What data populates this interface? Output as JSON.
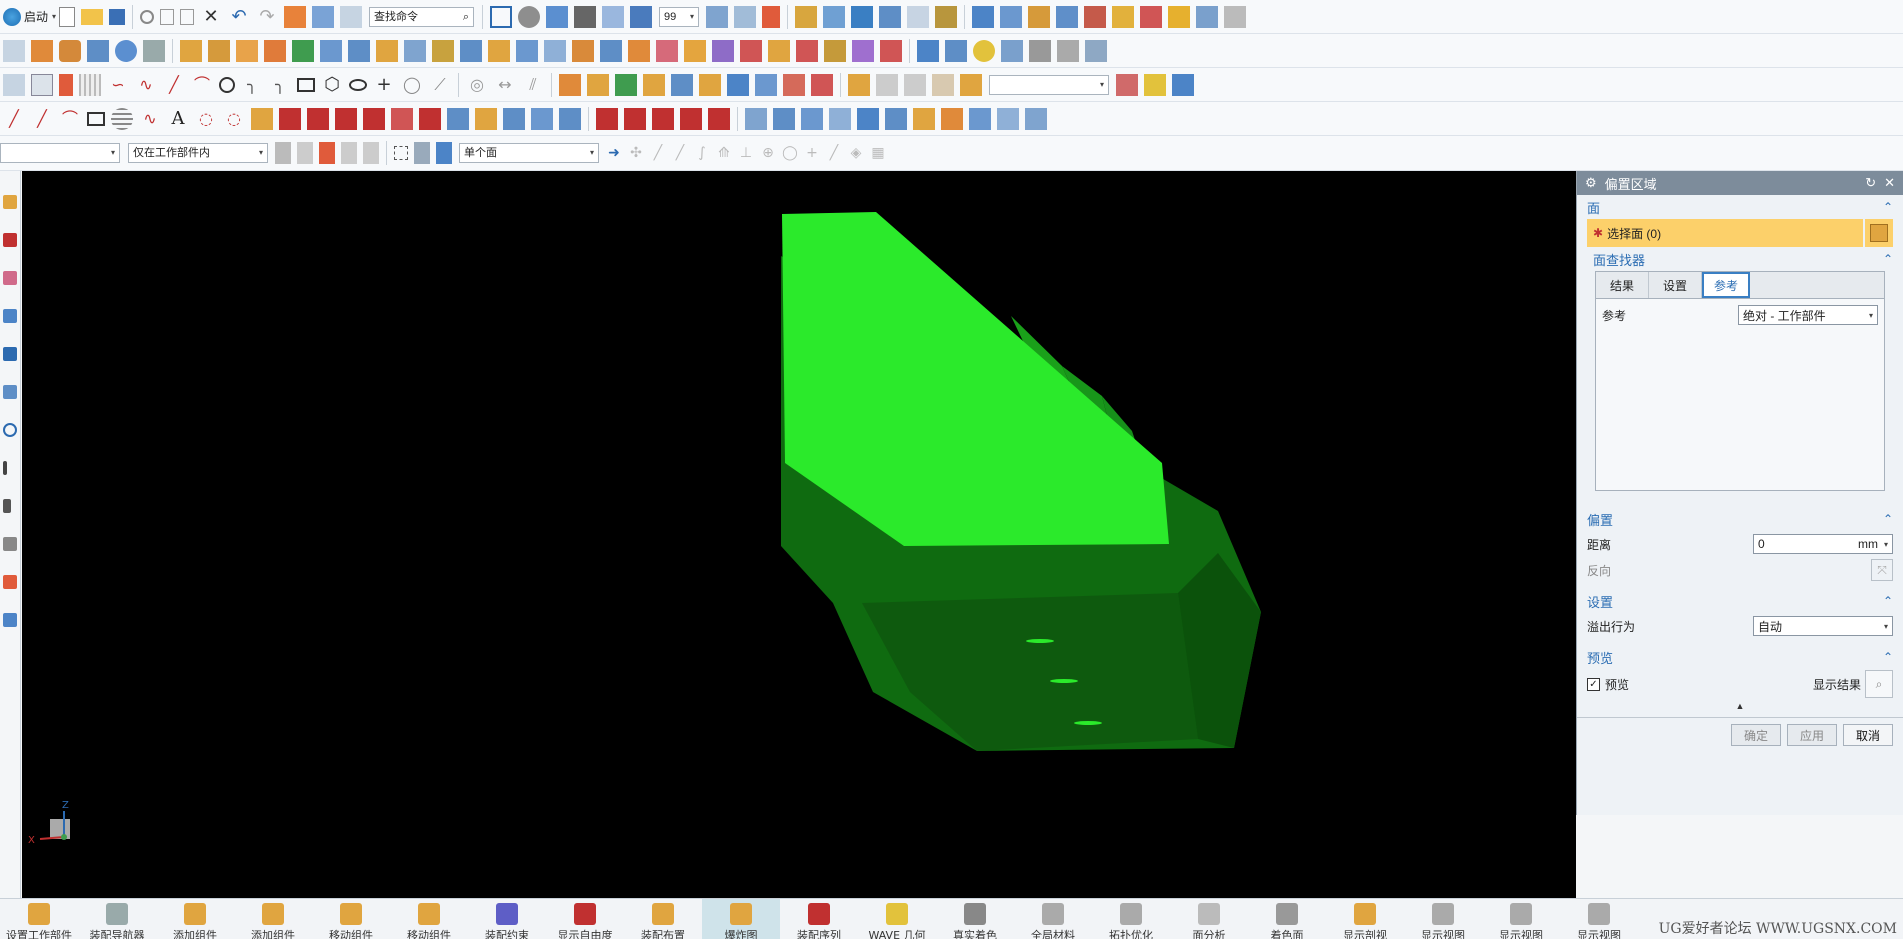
{
  "toolbar": {
    "start_label": "启动",
    "search_placeholder": "查找命令",
    "zoom_value": "99",
    "filter_scope": "仅在工作部件内",
    "face_rule": "单个面"
  },
  "panel": {
    "title": "偏置区域",
    "face_section": "面",
    "select_face_label": "选择面 (0)",
    "face_finder_section": "面查找器",
    "tabs": [
      "结果",
      "设置",
      "参考"
    ],
    "active_tab": "参考",
    "reference_label": "参考",
    "reference_value": "绝对 - 工作部件",
    "offset_section": "偏置",
    "distance_label": "距离",
    "distance_value": "0",
    "distance_unit": "mm",
    "reverse_label": "反向",
    "settings_section": "设置",
    "overflow_label": "溢出行为",
    "overflow_value": "自动",
    "preview_section": "预览",
    "preview_checkbox": "预览",
    "show_result": "显示结果",
    "ok": "确定",
    "apply": "应用",
    "cancel": "取消"
  },
  "triad": {
    "z": "Z",
    "x": "X"
  },
  "bottombar": {
    "items": [
      "设置工作部件",
      "装配导航器",
      "添加组件",
      "添加组件",
      "移动组件",
      "移动组件",
      "装配约束",
      "显示自由度",
      "装配布置",
      "爆炸图",
      "装配序列",
      "WAVE 几何",
      "真实着色",
      "全局材料",
      "拓扑优化",
      "面分析",
      "着色面",
      "显示剖视",
      "显示视图",
      "显示视图",
      "显示视图"
    ],
    "active_index": 9
  },
  "watermark": "UG爱好者论坛  WWW.UGSNX.COM",
  "colors": {
    "viewport_bg": "#000000",
    "model_top": "#2bea2b",
    "model_side": "#0f6b10",
    "panel_header": "#7d8c9b",
    "highlight": "#fcd06a"
  }
}
